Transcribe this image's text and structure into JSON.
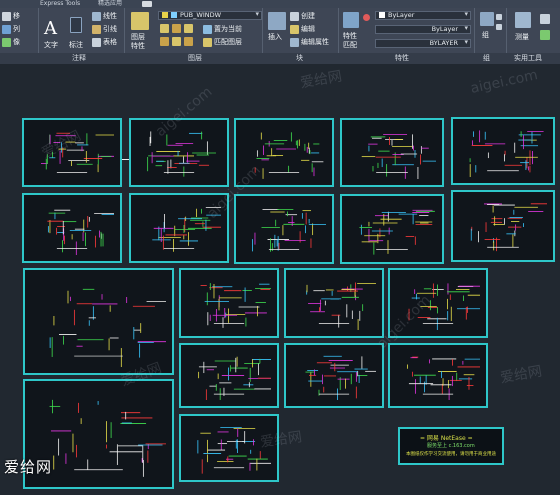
{
  "topbar": {
    "express_tools": "Express Tools",
    "featured_apps": "精选应用"
  },
  "ribbon": {
    "draw_col": [
      "移",
      "列",
      "像"
    ],
    "annotation": {
      "text_label": "文字",
      "dim_label": "标注",
      "line_label": "线性",
      "leader_label": "引线",
      "table_label": "表格",
      "panel_title": "注释"
    },
    "layers": {
      "props_label_1": "图层",
      "props_label_2": "特性",
      "layer_name": "PUB_WINDW",
      "set_current": "置为当前",
      "match_layer": "匹配图层",
      "panel_title": "图层"
    },
    "block": {
      "insert_label": "插入",
      "create_label": "创建",
      "edit_label": "编辑",
      "edit_attr_label": "编辑属性",
      "panel_title": "块"
    },
    "properties": {
      "match_props_1": "特性",
      "match_props_2": "匹配",
      "color_value": "ByLayer",
      "linetype_value": "ByLayer",
      "lineweight_value": "BYLAYER",
      "panel_title": "特性"
    },
    "groups": {
      "group_label": "组",
      "panel_title": "组"
    },
    "utilities": {
      "measure_label": "测量",
      "panel_title": "实用工具"
    }
  },
  "canvas": {
    "watermarks": [
      "爱给网",
      "aigei.com",
      "爱给网",
      "aigei.com",
      "爱给网",
      "aigei.com",
      "爱给网",
      "aigei.com",
      "爱给网"
    ],
    "bottom_logo": "爱给网"
  },
  "netbox": {
    "title": "= 网易 NetEase =",
    "subtitle": "服务至上 c.163.com",
    "note": "本图纸仅作学习交流使用，请勿用于商业用途"
  },
  "colors": {
    "frame": "#2ec7c9",
    "background": "#212830",
    "ribbon": "#3e4655"
  }
}
